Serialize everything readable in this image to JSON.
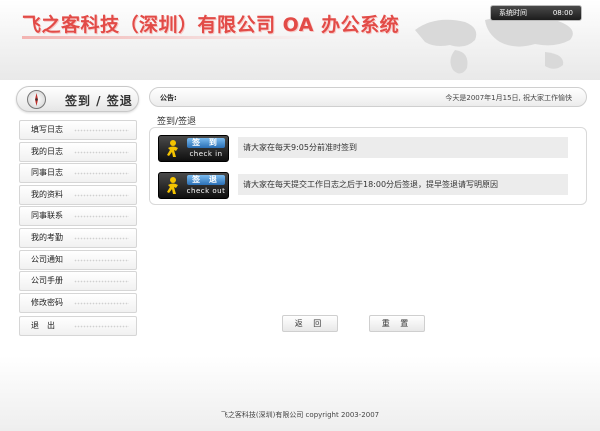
{
  "header": {
    "title": "飞之客科技（深圳）有限公司 OA 办公系统",
    "clock_label": "系统时间",
    "clock_time": "08:00"
  },
  "sidebar": {
    "title": "签到 / 签退",
    "items": [
      {
        "label": "填写日志"
      },
      {
        "label": "我的日志"
      },
      {
        "label": "同事日志"
      },
      {
        "label": "我的资料"
      },
      {
        "label": "同事联系"
      },
      {
        "label": "我的考勤"
      },
      {
        "label": "公司通知"
      },
      {
        "label": "公司手册"
      },
      {
        "label": "修改密码"
      },
      {
        "label": "退　出"
      }
    ]
  },
  "notice": {
    "label": "公告:",
    "message": "今天是2007年1月15日, 祝大家工作愉快"
  },
  "main": {
    "section_title": "签到/签退",
    "checkin": {
      "cn_label": "签 到",
      "en_label": "check in",
      "description": "请大家在每天9:05分前准时签到"
    },
    "checkout": {
      "cn_label": "签 退",
      "en_label": "check out",
      "description": "请大家在每天提交工作日志之后于18:00分后签退，提早签退请写明原因"
    }
  },
  "buttons": {
    "back": "返 回",
    "reset": "重 置"
  },
  "footer": {
    "text": "飞之客科技(深圳)有限公司 copyright 2003-2007"
  },
  "colors": {
    "brand_red": "#e24b47",
    "button_dark": "#1c1c1c",
    "button_accent_blue": "#2a6fb6"
  }
}
